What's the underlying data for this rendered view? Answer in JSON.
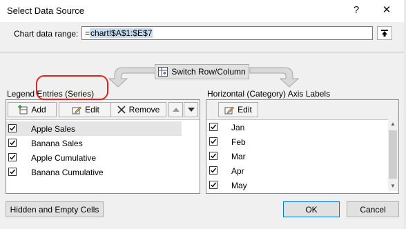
{
  "window": {
    "title": "Select Data Source",
    "help_label": "?",
    "close_label": "✕"
  },
  "range": {
    "label": "Chart data range:",
    "prefix": "=",
    "value": "chart!$A$1:$E$7"
  },
  "switch_button": {
    "label": "Switch Row/Column"
  },
  "legend": {
    "title": "Legend Entries (Series)",
    "add_label": "Add",
    "edit_label": "Edit",
    "remove_label": "Remove",
    "items": [
      {
        "label": "Apple Sales",
        "checked": true,
        "selected": true
      },
      {
        "label": "Banana Sales",
        "checked": true,
        "selected": false
      },
      {
        "label": "Apple Cumulative",
        "checked": true,
        "selected": false
      },
      {
        "label": "Banana Cumulative",
        "checked": true,
        "selected": false
      }
    ]
  },
  "axis": {
    "title": "Horizontal (Category) Axis Labels",
    "edit_label": "Edit",
    "items": [
      {
        "label": "Jan",
        "checked": true
      },
      {
        "label": "Feb",
        "checked": true
      },
      {
        "label": "Mar",
        "checked": true
      },
      {
        "label": "Apr",
        "checked": true
      },
      {
        "label": "May",
        "checked": true
      }
    ]
  },
  "footer": {
    "hidden_cells_label": "Hidden and Empty Cells",
    "ok_label": "OK",
    "cancel_label": "Cancel"
  },
  "colors": {
    "annotation": "#e0221e",
    "accent": "#0078d7"
  },
  "icons": [
    "help-icon",
    "close-icon",
    "collapse-icon",
    "switch-icon",
    "add-icon",
    "edit-icon",
    "remove-icon",
    "move-up-icon",
    "move-down-icon",
    "checkbox-icon",
    "arrow-icon"
  ]
}
